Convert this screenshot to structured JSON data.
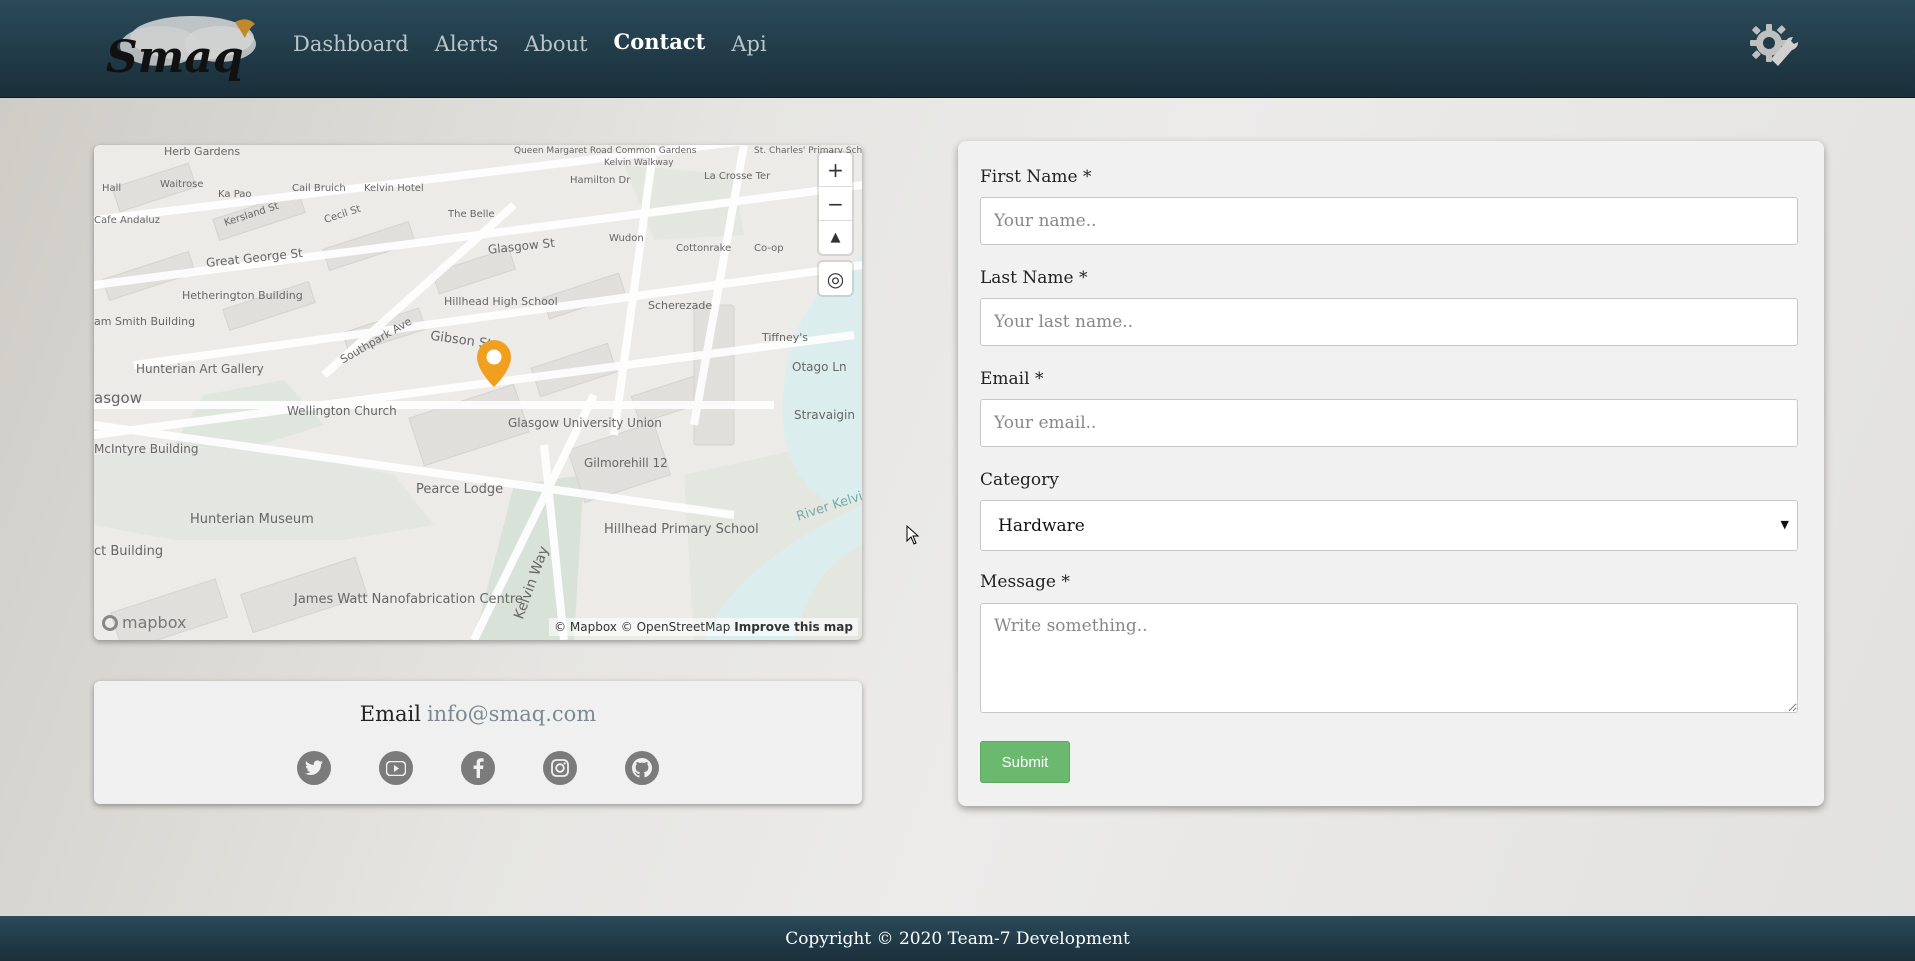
{
  "header": {
    "logo_text": "Smaq",
    "nav": [
      {
        "label": "Dashboard",
        "active": false
      },
      {
        "label": "Alerts",
        "active": false
      },
      {
        "label": "About",
        "active": false
      },
      {
        "label": "Contact",
        "active": true
      },
      {
        "label": "Api",
        "active": false
      }
    ],
    "settings_icon": "gear-wrench-icon"
  },
  "map": {
    "place_labels": [
      "Herb Gardens",
      "Queen Margaret Road Common Gardens",
      "St. Charles' Primary School",
      "Hall",
      "Waitrose",
      "Kelvin Walkway",
      "Hamilton Dr",
      "La Crosse Ter",
      "Ka Pao",
      "Cail Bruich",
      "Kelvin Hotel",
      "Cafe Andaluz",
      "Kersland St",
      "Cecil St",
      "The Belle",
      "Wudon",
      "Cottonrake",
      "Co-op",
      "Great George St",
      "Glasgow St",
      "Hetherington Building",
      "Hillhead High School",
      "Scherezade",
      "Tiffney's",
      "am Smith Building",
      "Southpark Ave",
      "Gibson St",
      "Otago Ln",
      "Hunterian Art Gallery",
      "asgow",
      "Wellington Church",
      "Glasgow University Union",
      "Stravaigin",
      "McIntyre Building",
      "Gilmorehill 12",
      "Pearce Lodge",
      "Hunterian Museum",
      "Hillhead Primary School",
      "River Kelvin",
      "ct Building",
      "James Watt Nanofabrication Centre",
      "Kelvin Way"
    ],
    "controls": {
      "zoom_in": "+",
      "zoom_out": "−",
      "compass": "▲",
      "locate": "◎"
    },
    "logo": "mapbox",
    "attribution": {
      "mapbox": "© Mapbox",
      "osm": "© OpenStreetMap",
      "improve": "Improve this map"
    },
    "marker_color": "#f0a01e"
  },
  "contact": {
    "email_label": "Email",
    "email_address": "info@smaq.com",
    "socials": [
      "twitter-icon",
      "youtube-icon",
      "facebook-icon",
      "instagram-icon",
      "github-icon"
    ]
  },
  "form": {
    "first_name": {
      "label": "First Name *",
      "placeholder": "Your name.."
    },
    "last_name": {
      "label": "Last Name *",
      "placeholder": "Your last name.."
    },
    "email": {
      "label": "Email *",
      "placeholder": "Your email.."
    },
    "category": {
      "label": "Category",
      "selected": "Hardware",
      "caret": "▼"
    },
    "message": {
      "label": "Message *",
      "placeholder": "Write something.."
    },
    "submit_label": "Submit",
    "submit_color": "#6ab96f"
  },
  "footer": {
    "copyright": "Copyright © 2020 Team-7 Development"
  },
  "colors": {
    "header_bg": "#1f3a47",
    "accent": "#6ab96f"
  }
}
